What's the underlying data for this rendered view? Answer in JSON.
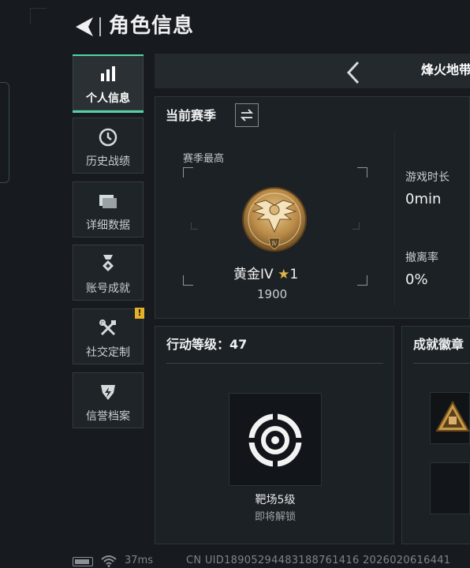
{
  "header": {
    "title": "角色信息"
  },
  "sidebar": {
    "items": [
      {
        "label": "个人信息",
        "icon": "bar-chart-icon",
        "active": true
      },
      {
        "label": "历史战绩",
        "icon": "clock-icon",
        "active": false
      },
      {
        "label": "详细数据",
        "icon": "folder-icon",
        "active": false
      },
      {
        "label": "账号成就",
        "icon": "medal-icon",
        "active": false
      },
      {
        "label": "社交定制",
        "icon": "tools-icon",
        "active": false,
        "badge": "!"
      },
      {
        "label": "信誉档案",
        "icon": "shield-bolt-icon",
        "active": false
      }
    ]
  },
  "topbar": {
    "title": "烽火地带"
  },
  "season": {
    "title": "当前赛季",
    "peak_label": "赛季最高",
    "rank_name": "黄金IV",
    "rank_stars": "1",
    "score": "1900",
    "stats": [
      {
        "label": "游戏时长",
        "value": "0min"
      },
      {
        "label": "撤离率",
        "value": "0%"
      }
    ]
  },
  "level": {
    "title": "行动等级：47",
    "range_name": "靶场5级",
    "range_status": "即将解锁"
  },
  "achievements": {
    "title": "成就徽章"
  },
  "footer": {
    "ping": "37ms",
    "uid": "CN UID18905294483188761416 2026020616441"
  },
  "colors": {
    "accent": "#54d2a4",
    "badge": "#e5b12a",
    "gold": "#c79a45"
  }
}
